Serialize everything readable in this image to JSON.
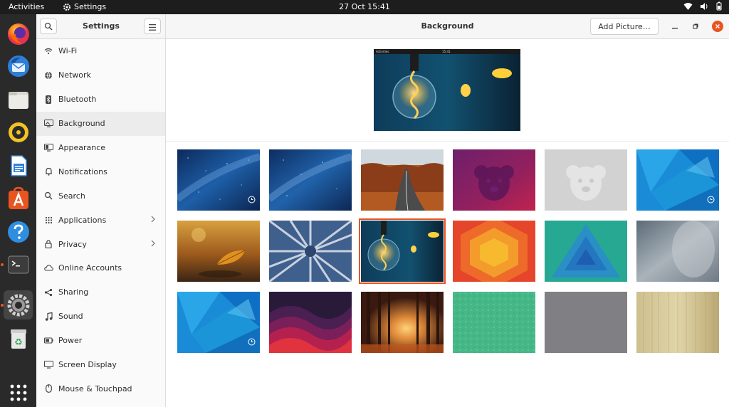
{
  "topbar": {
    "activities": "Activities",
    "app_name": "Settings",
    "clock": "27 Oct  15:41"
  },
  "dock": {
    "icons": [
      "firefox-icon",
      "thunderbird-icon",
      "files-icon",
      "rhythmbox-icon",
      "writer-icon",
      "app-center-icon",
      "help-icon",
      "terminal-icon",
      "settings-icon",
      "trash-icon",
      "app-grid-icon"
    ]
  },
  "sidebar": {
    "title": "Settings",
    "items": [
      {
        "label": "Wi-Fi",
        "icon": "wifi-icon"
      },
      {
        "label": "Network",
        "icon": "network-icon"
      },
      {
        "label": "Bluetooth",
        "icon": "bluetooth-icon"
      },
      {
        "label": "Background",
        "icon": "background-icon"
      },
      {
        "label": "Appearance",
        "icon": "appearance-icon"
      },
      {
        "label": "Notifications",
        "icon": "bell-icon"
      },
      {
        "label": "Search",
        "icon": "search-icon"
      },
      {
        "label": "Applications",
        "icon": "apps-icon"
      },
      {
        "label": "Privacy",
        "icon": "lock-icon"
      },
      {
        "label": "Online Accounts",
        "icon": "cloud-icon"
      },
      {
        "label": "Sharing",
        "icon": "share-icon"
      },
      {
        "label": "Sound",
        "icon": "music-note-icon"
      },
      {
        "label": "Power",
        "icon": "power-icon"
      },
      {
        "label": "Screen Display",
        "icon": "display-icon"
      },
      {
        "label": "Mouse & Touchpad",
        "icon": "mouse-icon"
      }
    ],
    "selected": "Background"
  },
  "main": {
    "title": "Background",
    "add_button": "Add Picture…",
    "preview_bar_left": "Activities",
    "preview_bar_clock": "15:41"
  },
  "wallpapers": [
    {
      "name": "milky-way-blue"
    },
    {
      "name": "milky-way-blue-2"
    },
    {
      "name": "autumn-road"
    },
    {
      "name": "purple-koala"
    },
    {
      "name": "grey-koala"
    },
    {
      "name": "blue-geometric"
    },
    {
      "name": "autumn-leaf"
    },
    {
      "name": "snowy-forest"
    },
    {
      "name": "lightbulb"
    },
    {
      "name": "orange-hexagon"
    },
    {
      "name": "green-blue-triangle"
    },
    {
      "name": "grey-blur"
    },
    {
      "name": "blue-geometric-2"
    },
    {
      "name": "purple-waves"
    },
    {
      "name": "forest-light"
    },
    {
      "name": "green-pattern"
    },
    {
      "name": "grey-solid"
    },
    {
      "name": "wood-texture"
    }
  ],
  "colors": {
    "accent": "#e95420",
    "dock_bg": "#2a2a2a",
    "topbar_bg": "#1d1d1d"
  }
}
